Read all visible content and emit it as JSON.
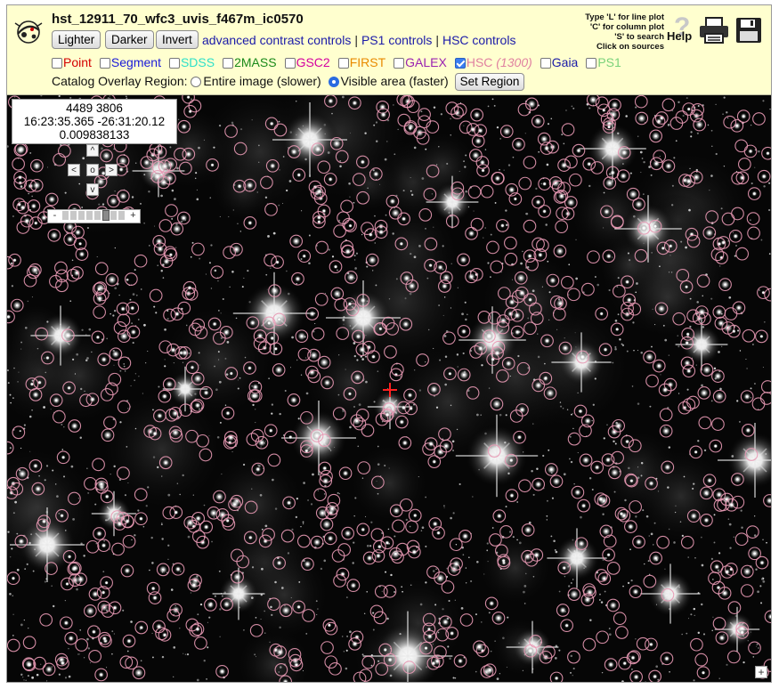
{
  "title": "hst_12911_70_wfc3_uvis_f467m_ic0570",
  "buttons": {
    "lighter": "Lighter",
    "darker": "Darker",
    "invert": "Invert"
  },
  "links": {
    "advanced": "advanced contrast controls",
    "ps1": "PS1 controls",
    "hsc": "HSC controls",
    "separator": "|"
  },
  "catalogs": [
    {
      "label": "Point",
      "checked": false,
      "color": "#d40000"
    },
    {
      "label": "Segment",
      "checked": false,
      "color": "#1a1ad8"
    },
    {
      "label": "SDSS",
      "checked": false,
      "color": "#2ee0c8"
    },
    {
      "label": "2MASS",
      "checked": false,
      "color": "#1a8a1a"
    },
    {
      "label": "GSC2",
      "checked": false,
      "color": "#d400a0"
    },
    {
      "label": "FIRST",
      "checked": false,
      "color": "#e88a00"
    },
    {
      "label": "GALEX",
      "checked": false,
      "color": "#9a22b0"
    },
    {
      "label": "HSC",
      "checked": true,
      "color": "#e080a0",
      "count": "(1300)"
    },
    {
      "label": "Gaia",
      "checked": false,
      "color": "#1a1aa8"
    },
    {
      "label": "PS1",
      "checked": false,
      "color": "#7ad27a"
    }
  ],
  "region": {
    "label": "Catalog Overlay Region:",
    "option_entire": "Entire image (slower)",
    "option_visible": "Visible area (faster)",
    "selected": "visible",
    "set_button": "Set Region"
  },
  "hints": [
    "Type 'L' for line plot",
    "'C' for column plot",
    "'S' to search",
    "Click on sources"
  ],
  "help_label": "Help",
  "readout": {
    "pixel": "4489 3806",
    "coords": "16:23:35.365 -26:31:20.12",
    "value": "0.009838133"
  },
  "nav": {
    "up": "^",
    "left": "<",
    "center": "o",
    "right": ">",
    "down": "v",
    "zoom_minus": "-",
    "zoom_plus": "+",
    "zoom_level": 0.72
  },
  "expand_label": "+",
  "colors": {
    "toolbar_bg": "#ffffcf",
    "overlay_circle": "#e899b4",
    "cursor": "#ff2020"
  }
}
